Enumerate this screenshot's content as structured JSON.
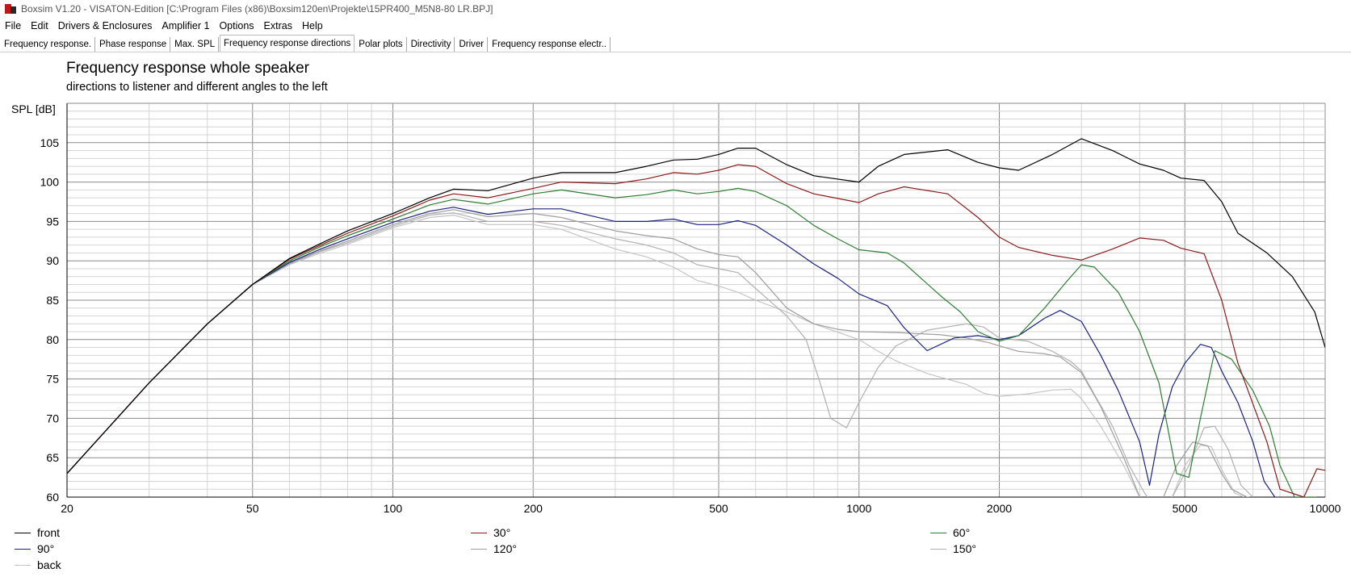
{
  "window": {
    "title": "Boxsim V1.20 - VISATON-Edition [C:\\Program Files (x86)\\Boxsim120en\\Projekte\\15PR400_M5N8-80 LR.BPJ]"
  },
  "menu": [
    "File",
    "Edit",
    "Drivers & Enclosures",
    "Amplifier 1",
    "Options",
    "Extras",
    "Help"
  ],
  "tabs": [
    {
      "label": "Frequency response.",
      "active": false
    },
    {
      "label": "Phase response",
      "active": false
    },
    {
      "label": "Max. SPL",
      "active": false
    },
    {
      "label": "Frequency response directions",
      "active": true
    },
    {
      "label": "Polar plots",
      "active": false
    },
    {
      "label": "Directivity",
      "active": false
    },
    {
      "label": "Driver",
      "active": false
    },
    {
      "label": "Frequency response electr..",
      "active": false
    }
  ],
  "chart_data": {
    "type": "line",
    "title": "Frequency response whole speaker",
    "subtitle": "directions to listener and different angles to the left",
    "ylabel": "SPL [dB]",
    "xlabel": "",
    "xscale": "log",
    "xlim": [
      20,
      10000
    ],
    "ylim": [
      60,
      110
    ],
    "x_ticks": [
      20,
      50,
      100,
      200,
      500,
      1000,
      2000,
      5000,
      10000
    ],
    "x_tick_labels": [
      "20",
      "50",
      "100",
      "200",
      "500",
      "1000",
      "2000",
      "5000",
      "10000"
    ],
    "y_ticks": [
      60,
      65,
      70,
      75,
      80,
      85,
      90,
      95,
      100,
      105
    ],
    "grid": true,
    "legend_position": "bottom",
    "series": [
      {
        "name": "front",
        "color": "#000000",
        "x": [
          20,
          30,
          40,
          50,
          60,
          70,
          80,
          100,
          120,
          135,
          160,
          200,
          230,
          300,
          350,
          400,
          450,
          500,
          550,
          600,
          700,
          800,
          1000,
          1100,
          1250,
          1550,
          1800,
          2000,
          2200,
          2600,
          3000,
          3500,
          4000,
          4500,
          4900,
          5500,
          6000,
          6500,
          7500,
          8500,
          9500,
          10000
        ],
        "y": [
          63,
          74.5,
          82,
          87,
          90.3,
          92.2,
          93.8,
          96,
          98,
          99.1,
          98.9,
          100.5,
          101.2,
          101.2,
          102,
          102.8,
          102.9,
          103.5,
          104.3,
          104.3,
          102.2,
          100.8,
          100,
          102,
          103.5,
          104.1,
          102.5,
          101.8,
          101.5,
          103.5,
          105.5,
          104,
          102.3,
          101.5,
          100.5,
          100.2,
          97.5,
          93.5,
          91,
          88,
          83.5,
          79
        ]
      },
      {
        "name": "30°",
        "color": "#8b1a1a",
        "x": [
          20,
          30,
          40,
          50,
          60,
          70,
          80,
          100,
          120,
          135,
          160,
          200,
          230,
          300,
          350,
          400,
          450,
          500,
          550,
          600,
          700,
          800,
          1000,
          1100,
          1250,
          1550,
          1800,
          2000,
          2200,
          2600,
          3000,
          3500,
          4000,
          4500,
          4900,
          5500,
          6000,
          6500,
          7500,
          8000,
          9000,
          9600,
          10000
        ],
        "y": [
          63,
          74.5,
          82,
          87,
          90.2,
          92,
          93.5,
          95.7,
          97.7,
          98.5,
          98,
          99.2,
          100,
          99.8,
          100.4,
          101.2,
          101,
          101.5,
          102.2,
          102,
          99.8,
          98.5,
          97.4,
          98.5,
          99.4,
          98.5,
          95.5,
          93,
          91.7,
          90.7,
          90.1,
          91.5,
          92.9,
          92.6,
          91.6,
          90.9,
          85,
          77,
          67,
          61,
          60,
          63.6,
          63.4
        ]
      },
      {
        "name": "60°",
        "color": "#2e7d32",
        "x": [
          20,
          30,
          40,
          50,
          60,
          70,
          80,
          100,
          120,
          135,
          160,
          200,
          230,
          300,
          350,
          400,
          450,
          500,
          550,
          600,
          700,
          800,
          900,
          1000,
          1150,
          1250,
          1500,
          1650,
          1800,
          2000,
          2200,
          2500,
          2800,
          3000,
          3200,
          3600,
          4000,
          4400,
          4800,
          5100,
          5400,
          5800,
          6300,
          7000,
          7600,
          8000,
          8600,
          9500,
          10000
        ],
        "y": [
          63,
          74.5,
          82,
          87,
          90,
          91.8,
          93.2,
          95.3,
          97.1,
          97.8,
          97.2,
          98.5,
          99,
          98,
          98.4,
          99,
          98.5,
          98.8,
          99.2,
          98.8,
          97,
          94.5,
          92.8,
          91.4,
          91,
          89.7,
          85.5,
          83.5,
          81,
          79.8,
          80.5,
          84,
          87.5,
          89.5,
          89.2,
          86,
          81,
          74.5,
          63,
          62.5,
          70,
          78.6,
          77.5,
          73.5,
          69,
          64,
          60,
          60,
          59.7
        ]
      },
      {
        "name": "90°",
        "color": "#1a237e",
        "x": [
          20,
          30,
          40,
          50,
          60,
          70,
          80,
          100,
          120,
          135,
          160,
          200,
          230,
          300,
          350,
          400,
          450,
          500,
          550,
          600,
          700,
          800,
          900,
          1000,
          1150,
          1250,
          1400,
          1600,
          1800,
          2000,
          2200,
          2500,
          2700,
          3000,
          3300,
          3600,
          4000,
          4200,
          4400,
          4700,
          5000,
          5400,
          5700,
          6000,
          6500,
          7000,
          7400,
          7800
        ],
        "y": [
          63,
          74.5,
          82,
          87,
          89.8,
          91.5,
          92.8,
          94.9,
          96.3,
          96.8,
          95.9,
          96.6,
          96.6,
          95,
          95,
          95.3,
          94.6,
          94.6,
          95.1,
          94.5,
          92,
          89.6,
          87.8,
          85.8,
          84.3,
          81.5,
          78.6,
          80.2,
          80.5,
          80,
          80.5,
          82.7,
          83.7,
          82.3,
          78,
          73.5,
          67,
          61.5,
          68,
          74,
          77,
          79.4,
          79,
          76,
          72,
          67,
          62,
          60
        ]
      },
      {
        "name": "120°",
        "color": "#9e9e9e",
        "x": [
          20,
          30,
          40,
          50,
          60,
          70,
          80,
          100,
          120,
          135,
          160,
          200,
          230,
          300,
          350,
          400,
          450,
          500,
          550,
          600,
          700,
          800,
          900,
          1000,
          1200,
          1500,
          1700,
          1900,
          2000,
          2200,
          2500,
          2700,
          3000,
          3300,
          3700,
          4000,
          4200,
          4500,
          4800,
          5200,
          5600,
          6000,
          6300,
          6800,
          7200
        ],
        "y": [
          63,
          74.5,
          82,
          87,
          89.7,
          91.3,
          92.5,
          94.6,
          96,
          96.5,
          95.6,
          96,
          95.5,
          93.8,
          93.2,
          92.8,
          91.5,
          90.8,
          90.5,
          88.5,
          84,
          82,
          81.3,
          81,
          80.9,
          80.6,
          80.2,
          79.6,
          79.2,
          78.5,
          78.2,
          77.8,
          75.8,
          71.5,
          65,
          60,
          58,
          60,
          64,
          67,
          66.5,
          63,
          61,
          60,
          59.8
        ]
      },
      {
        "name": "150°",
        "color": "#b0b0b0",
        "x": [
          20,
          30,
          40,
          50,
          60,
          70,
          80,
          100,
          120,
          135,
          160,
          200,
          230,
          300,
          350,
          400,
          450,
          500,
          550,
          600,
          700,
          770,
          820,
          870,
          940,
          1000,
          1100,
          1200,
          1400,
          1700,
          1850,
          2000,
          2300,
          2600,
          2850,
          3000,
          3200,
          3500,
          3800,
          4100,
          4400,
          4700,
          5100,
          5500,
          5800,
          6200,
          6600,
          7000
        ],
        "y": [
          63,
          74.5,
          82,
          87,
          89.6,
          91.2,
          92.3,
          94.4,
          95.8,
          96.1,
          95,
          95,
          94.5,
          92.8,
          92,
          91,
          89.5,
          89,
          88.5,
          86.5,
          83,
          80,
          75,
          70,
          68.8,
          72,
          76.5,
          79.2,
          81.2,
          82,
          81.6,
          80.2,
          79.8,
          78.5,
          77.2,
          76,
          73,
          69,
          64,
          60.5,
          58,
          60,
          64,
          68.8,
          69,
          66,
          61.5,
          60
        ]
      },
      {
        "name": "back",
        "color": "#c4c4c4",
        "x": [
          20,
          30,
          40,
          50,
          60,
          70,
          80,
          100,
          120,
          135,
          160,
          200,
          230,
          300,
          350,
          400,
          450,
          500,
          550,
          600,
          700,
          800,
          1000,
          1100,
          1200,
          1400,
          1700,
          1850,
          2000,
          2300,
          2600,
          2850,
          3000,
          3300,
          3700,
          4000,
          4300,
          4700,
          5000,
          5400,
          5700,
          6000,
          6400,
          6700
        ],
        "y": [
          63,
          74.5,
          82,
          87,
          89.5,
          91,
          92.1,
          94.2,
          95.5,
          95.8,
          94.6,
          94.6,
          94,
          91.5,
          90.5,
          89.2,
          87.5,
          86.8,
          86,
          85,
          83.5,
          82,
          80,
          78.5,
          77.3,
          75.7,
          74.3,
          73.2,
          72.8,
          73.1,
          73.6,
          73.7,
          72.5,
          69,
          64,
          60,
          58,
          60,
          64,
          66.6,
          66.4,
          63.5,
          60.5,
          60
        ]
      }
    ]
  }
}
